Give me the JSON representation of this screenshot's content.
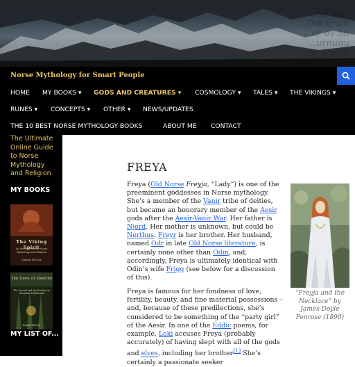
{
  "site": {
    "title": "Norse Mythology for Smart People"
  },
  "colors": {
    "accent": "#e9c36a",
    "link": "#2161e0",
    "search_button": "#2161e0",
    "nav_bg": "#000000"
  },
  "banner": {
    "overlay_text": "...nd mar\n...Oskar sin\n...ør av Sh\n...urnunu\n...ur alnen."
  },
  "nav": {
    "row1": [
      "HOME",
      "MY BOOKS ▾",
      "GODS AND CREATURES ▾",
      "COSMOLOGY ▾",
      "TALES ▾",
      "THE VIKINGS ▾"
    ],
    "row2": [
      "RUNES ▾",
      "CONCEPTS ▾",
      "OTHER ▾",
      "NEWS/UPDATES"
    ],
    "row3": [
      "THE 10 BEST NORSE MYTHOLOGY BOOKS",
      "ABOUT ME",
      "CONTACT"
    ]
  },
  "sidebar": {
    "tagline": "The Ultimate Online Guide to Norse Mythology and Religion",
    "books_heading": "MY BOOKS",
    "book1": {
      "title": "The Viking Spirit",
      "subtitle": "An Introduction to Norse Mythology and Religion",
      "author": "Daniel McCoy"
    },
    "book2": {
      "title": "The Love of Destiny",
      "subtitle": "The Sacred and the Profane in Germanic Polytheism",
      "author": "Daniel McCoy"
    },
    "list_heading": "MY LIST OF..."
  },
  "article": {
    "title": "FREYA",
    "p1": {
      "t1": "Freya (",
      "l1": "Old Norse",
      "t2": " ",
      "i1": "Freyja",
      "t3": ", “Lady”) is one of the preeminent goddesses in Norse mythology. She’s a member of the ",
      "l2": "Vanir",
      "t4": " tribe of deities, but became an honorary member of the ",
      "l3": "Aesir",
      "t5": " gods after the ",
      "l4": "Aesir-Vanir War",
      "t6": ". Her father is ",
      "l5": "Njord",
      "t7": ". Her mother is unknown, but could be ",
      "l6": "Nerthus",
      "t8": ". ",
      "l7": "Freyr",
      "t9": " is her brother. Her husband, named ",
      "l8": "Odr",
      "t10": " in late ",
      "l9": "Old Norse literature",
      "t11": ", is certainly none other than ",
      "l10": "Odin",
      "t12": ", and, accordingly, Freya is ultimately identical with Odin’s wife ",
      "l11": "Frigg",
      "t13": " (see below for a discussion of this)."
    },
    "p2": {
      "t1": "Freya is famous for her fondness of love, fertility, beauty, and fine material possessions – and, because of these predilections, she’s considered to be something of the “party girl” of the Aesir. In one of the ",
      "l1": "Eddic",
      "t2": " poems, for example, ",
      "l2": "Loki",
      "t3": " accuses Freya (probably accurately) of having slept with all of the gods and ",
      "l3": "elves",
      "t4": ", including her brother",
      "fn": "[1]",
      "t5": " She’s certainly a passionate seeker"
    },
    "figure_caption": "“Freyja and the Necklace” by James Doyle Penrose (1890)"
  }
}
